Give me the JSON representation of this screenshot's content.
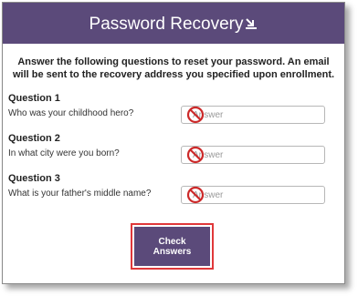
{
  "header": {
    "title": "Password Recovery"
  },
  "intro": "Answer the following questions to reset your password. An email will be sent to the recovery address you specified upon enrollment.",
  "questions": [
    {
      "heading": "Question 1",
      "text": "Who was your childhood hero?",
      "placeholder": "Answer"
    },
    {
      "heading": "Question 2",
      "text": "In what city were you born?",
      "placeholder": "Answer"
    },
    {
      "heading": "Question 3",
      "text": "What is your father's middle name?",
      "placeholder": "Answer"
    }
  ],
  "actions": {
    "check_label": "Check Answers"
  },
  "colors": {
    "brand": "#5b4a7a",
    "highlight": "#e0383a",
    "prohibit": "#cc2a2a"
  },
  "icons": {
    "header": "reset-password-icon",
    "field_overlay": "no-entry-icon"
  }
}
